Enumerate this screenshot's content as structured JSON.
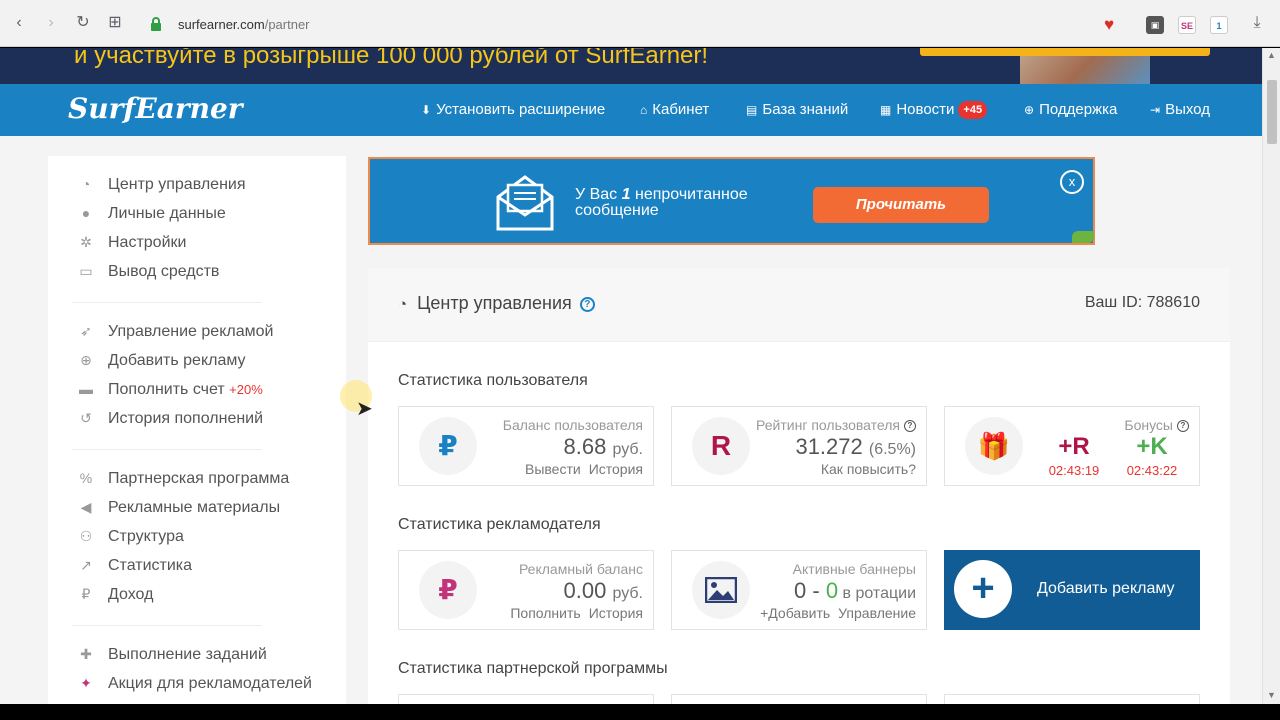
{
  "browser": {
    "url_host": "surfearner.com",
    "url_path": "/partner",
    "back_icon": "‹",
    "forward_icon": "›",
    "reload_icon": "↻",
    "apps_icon": "⊞",
    "ext2_label": "SE",
    "ext3_count": "1",
    "download_icon": "⤓"
  },
  "promo": {
    "text": "и участвуйте в розыгрыше 100 000 рублей от SurfEarner!"
  },
  "topnav": {
    "logo": "SurfEarner",
    "items": [
      {
        "icon": "⬇",
        "label": "Установить расширение"
      },
      {
        "icon": "⌂",
        "label": "Кабинет"
      },
      {
        "icon": "▤",
        "label": "База знаний"
      },
      {
        "icon": "▦",
        "label": "Новости"
      },
      {
        "icon": "⊕",
        "label": "Поддержка"
      },
      {
        "icon": "⇥",
        "label": "Выход"
      }
    ],
    "news_badge": "+45"
  },
  "sidebar": {
    "items": [
      {
        "icon": "◔",
        "label": "Центр управления"
      },
      {
        "icon": "●",
        "label": "Личные данные"
      },
      {
        "icon": "✲",
        "label": "Настройки"
      },
      {
        "icon": "▭",
        "label": "Вывод средств"
      },
      {
        "icon": "➶",
        "label": "Управление рекламой"
      },
      {
        "icon": "⊕",
        "label": "Добавить рекламу"
      },
      {
        "icon": "▬",
        "label": "Пополнить счет",
        "extra": "+20%"
      },
      {
        "icon": "↺",
        "label": "История пополнений"
      },
      {
        "icon": "%",
        "label": "Партнерская программа"
      },
      {
        "icon": "◀",
        "label": "Рекламные материалы"
      },
      {
        "icon": "⚇",
        "label": "Структура"
      },
      {
        "icon": "↗",
        "label": "Статистика"
      },
      {
        "icon": "₽",
        "label": "Доход"
      },
      {
        "icon": "✚",
        "label": "Выполнение заданий"
      },
      {
        "icon": "✦",
        "label": "Акция для рекламодателей"
      }
    ]
  },
  "message": {
    "text_before": "У Вас ",
    "count": "1",
    "text_after": " непрочитанное сообщение",
    "button": "Прочитать",
    "close": "x"
  },
  "panel": {
    "title": "Центр управления",
    "help": "?",
    "id_label": "Ваш ID: 788610"
  },
  "user_stats": {
    "title": "Статистика пользователя",
    "balance": {
      "icon": "₽",
      "label": "Баланс пользователя",
      "value": "8.68",
      "unit": "руб.",
      "link1": "Вывести",
      "link2": "История"
    },
    "rating": {
      "icon": "R",
      "label": "Рейтинг пользователя",
      "value": "31.272",
      "pct": "(6.5%)",
      "link1": "Как повысить?"
    },
    "bonus": {
      "label": "Бонусы",
      "r_label": "+R",
      "r_time": "02:43:19",
      "k_label": "+K",
      "k_time": "02:43:22"
    }
  },
  "adv_stats": {
    "title": "Статистика рекламодателя",
    "balance": {
      "icon": "₽",
      "label": "Рекламный баланс",
      "value": "0.00",
      "unit": "руб.",
      "link1": "Пополнить",
      "link2": "История"
    },
    "banners": {
      "label": "Активные баннеры",
      "v1": "0",
      "dash": " - ",
      "v2": "0",
      "suffix": " в ротации",
      "link1": "+Добавить",
      "link2": "Управление"
    },
    "add": {
      "icon": "+",
      "label": "Добавить рекламу"
    }
  },
  "partner_stats": {
    "title": "Статистика партнерской программы"
  },
  "colors": {
    "primary": "#1a82c3",
    "dark_primary": "#115c94",
    "accent_orange": "#f26b34",
    "badge_red": "#e8332e",
    "rating_red": "#b0154a",
    "adv_pink": "#c2347a",
    "bonus_green": "#4caf50"
  }
}
